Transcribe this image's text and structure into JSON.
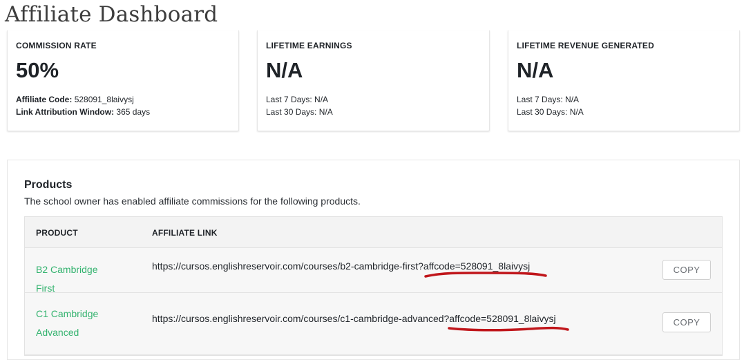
{
  "page": {
    "title": "Affiliate Dashboard"
  },
  "stats": [
    {
      "label": "COMMISSION RATE",
      "value": "50%",
      "meta": [
        {
          "key": "Affiliate Code:",
          "value": "528091_8laivysj"
        },
        {
          "key": "Link Attribution Window:",
          "value": "365 days"
        }
      ]
    },
    {
      "label": "LIFETIME EARNINGS",
      "value": "N/A",
      "meta": [
        {
          "text": "Last 7 Days: N/A"
        },
        {
          "text": "Last 30 Days: N/A"
        }
      ]
    },
    {
      "label": "LIFETIME REVENUE GENERATED",
      "value": "N/A",
      "meta": [
        {
          "text": "Last 7 Days: N/A"
        },
        {
          "text": "Last 30 Days: N/A"
        }
      ]
    }
  ],
  "products": {
    "title": "Products",
    "description": "The school owner has enabled affiliate commissions for the following products.",
    "columns": [
      "PRODUCT",
      "AFFILIATE LINK"
    ],
    "rows": [
      {
        "product": "B2 Cambridge First",
        "link": "https://cursos.englishreservoir.com/courses/b2-cambridge-first?affcode=528091_8laivysj",
        "copy_label": "COPY"
      },
      {
        "product": "C1 Cambridge Advanced",
        "link": "https://cursos.englishreservoir.com/courses/c1-cambridge-advanced?affcode=528091_8laivysj",
        "copy_label": "COPY"
      }
    ]
  },
  "colors": {
    "accent_green": "#34b36f",
    "annotation_red": "#c0161b"
  }
}
